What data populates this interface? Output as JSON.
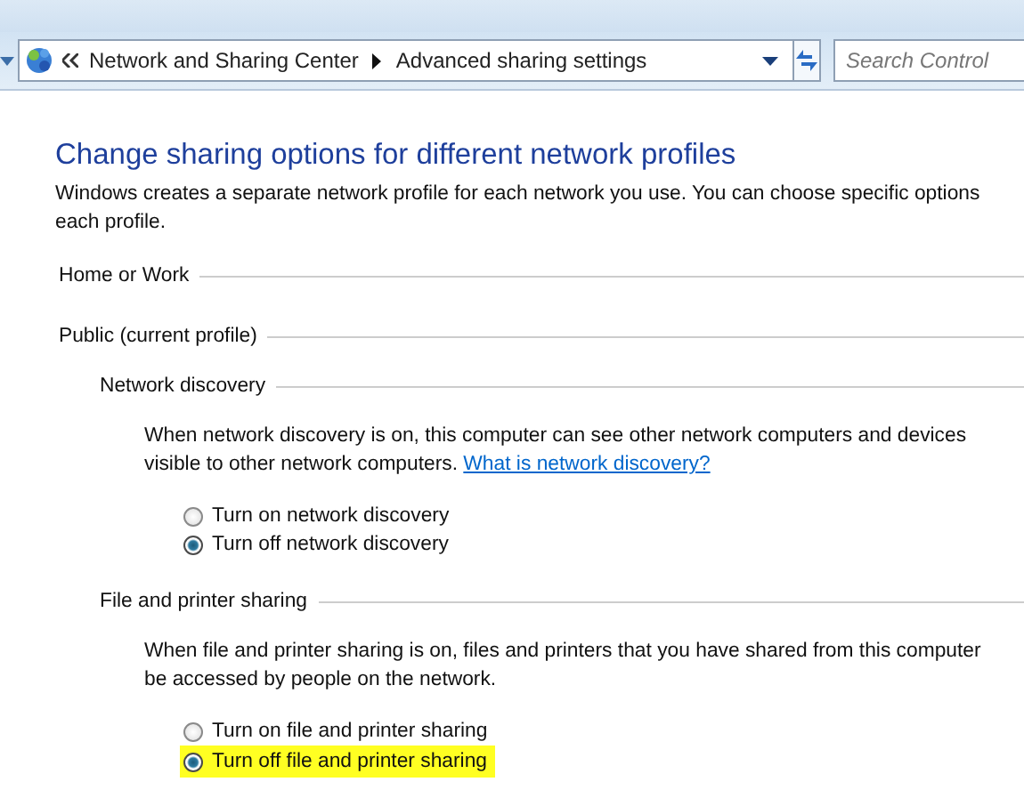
{
  "address_bar": {
    "crumbs": [
      "Network and Sharing Center",
      "Advanced sharing settings"
    ],
    "search": {
      "placeholder": "Search Control"
    }
  },
  "heading": "Change sharing options for different network profiles",
  "intro_lines": [
    "Windows creates a separate network profile for each network you use. You can choose specific options",
    "each profile."
  ],
  "profiles": [
    {
      "label": "Home or Work"
    },
    {
      "label": "Public (current profile)",
      "sections": [
        {
          "title": "Network discovery",
          "lines": [
            {
              "text": "When network discovery is on, this computer can see other network computers and devices"
            },
            {
              "text": "visible to other network computers.",
              "link": "What is network discovery?"
            }
          ],
          "options": [
            {
              "label": "Turn on network discovery",
              "selected": false,
              "highlighted": false
            },
            {
              "label": "Turn off network discovery",
              "selected": true,
              "highlighted": false
            }
          ]
        },
        {
          "title": "File and printer sharing",
          "lines": [
            {
              "text": "When file and printer sharing is on, files and printers that you have shared from this computer"
            },
            {
              "text": "be accessed by people on the network."
            }
          ],
          "options": [
            {
              "label": "Turn on file and printer sharing",
              "selected": false,
              "highlighted": false
            },
            {
              "label": "Turn off file and printer sharing",
              "selected": true,
              "highlighted": true
            }
          ]
        }
      ]
    }
  ]
}
